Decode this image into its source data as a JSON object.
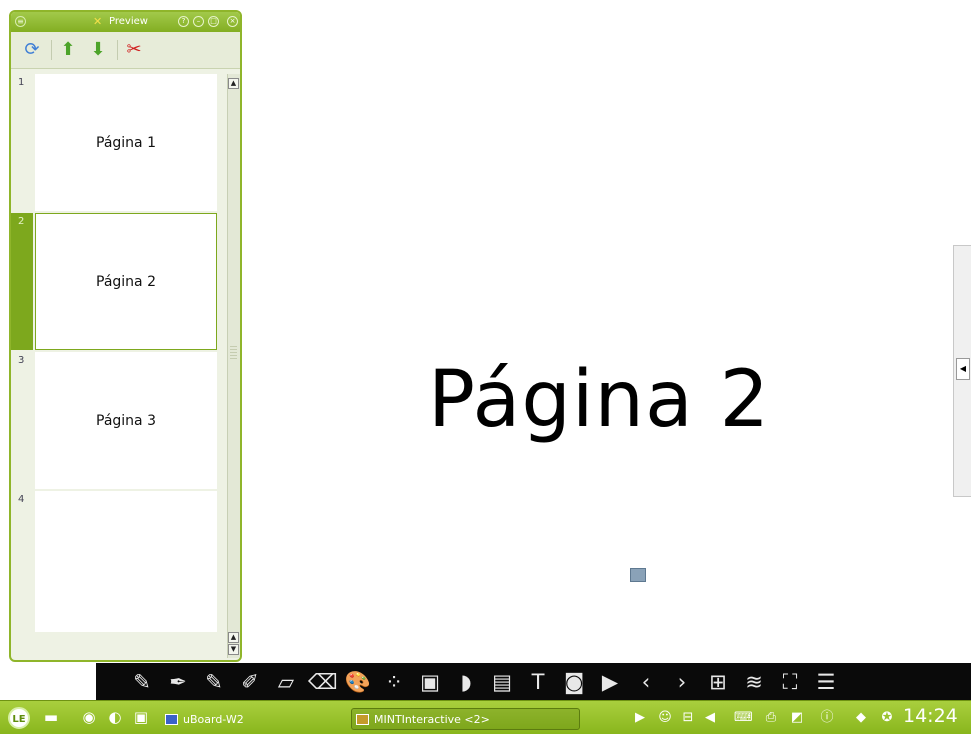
{
  "preview_window": {
    "title": "Preview",
    "menu_icon": "menu-circle-icon",
    "window_buttons": [
      "help-icon",
      "minimize-icon",
      "maximize-icon",
      "close-icon"
    ],
    "toolbar": [
      {
        "name": "refresh-icon",
        "glyph": "⟳",
        "color": "#3f7fd6"
      },
      {
        "name": "move-up-icon",
        "glyph": "⬆",
        "color": "#4da42a"
      },
      {
        "name": "move-down-icon",
        "glyph": "⬇",
        "color": "#4da42a"
      },
      {
        "name": "cut-icon",
        "glyph": "✂",
        "color": "#d02020"
      }
    ],
    "pages": [
      {
        "number": "1",
        "label": "Página 1",
        "selected": false
      },
      {
        "number": "2",
        "label": "Página 2",
        "selected": true
      },
      {
        "number": "3",
        "label": "Página 3",
        "selected": false
      },
      {
        "number": "4",
        "label": "",
        "selected": false
      }
    ]
  },
  "canvas": {
    "title": "Página 2",
    "small_icon": "image-icon",
    "side_handle_icon": "collapse-left-icon"
  },
  "draw_toolbar": {
    "tools": [
      {
        "name": "color-tool-icon",
        "glyph": "✎"
      },
      {
        "name": "pen-fine-icon",
        "glyph": "✒"
      },
      {
        "name": "pen-medium-icon",
        "glyph": "✎"
      },
      {
        "name": "pen-thick-icon",
        "glyph": "✐"
      },
      {
        "name": "eraser-icon",
        "glyph": "▱"
      },
      {
        "name": "erase-all-icon",
        "glyph": "⌫"
      },
      {
        "name": "palette-icon",
        "glyph": "🎨"
      },
      {
        "name": "points-icon",
        "glyph": "⁘"
      },
      {
        "name": "image-insert-icon",
        "glyph": "▣"
      },
      {
        "name": "shape-icon",
        "glyph": "◗"
      },
      {
        "name": "sticky-note-icon",
        "glyph": "▤"
      },
      {
        "name": "text-tool-icon",
        "glyph": "T"
      },
      {
        "name": "camera-icon",
        "glyph": "◙"
      },
      {
        "name": "video-icon",
        "glyph": "▶"
      },
      {
        "name": "previous-page-icon",
        "glyph": "‹"
      },
      {
        "name": "next-page-icon",
        "glyph": "›"
      },
      {
        "name": "add-page-icon",
        "glyph": "⊞"
      },
      {
        "name": "layers-icon",
        "glyph": "≋"
      },
      {
        "name": "fullscreen-icon",
        "glyph": "⛶"
      },
      {
        "name": "list-menu-icon",
        "glyph": "☰"
      }
    ]
  },
  "taskbar": {
    "start_label": "LE",
    "launchers": [
      "desktop-icon",
      "files-icon",
      "browser-icon",
      "terminal-icon"
    ],
    "tasks": [
      {
        "label": "uBoard-W2",
        "active": false
      },
      {
        "label": "MINTInteractive <2>",
        "active": true
      }
    ],
    "tray": [
      "play-icon",
      "user-icon",
      "network-icon",
      "volume-icon",
      "keyboard-icon",
      "printer-icon",
      "board-icon",
      "info-icon",
      "package-icon",
      "help-lifebuoy-icon"
    ],
    "clock": "14:24"
  }
}
